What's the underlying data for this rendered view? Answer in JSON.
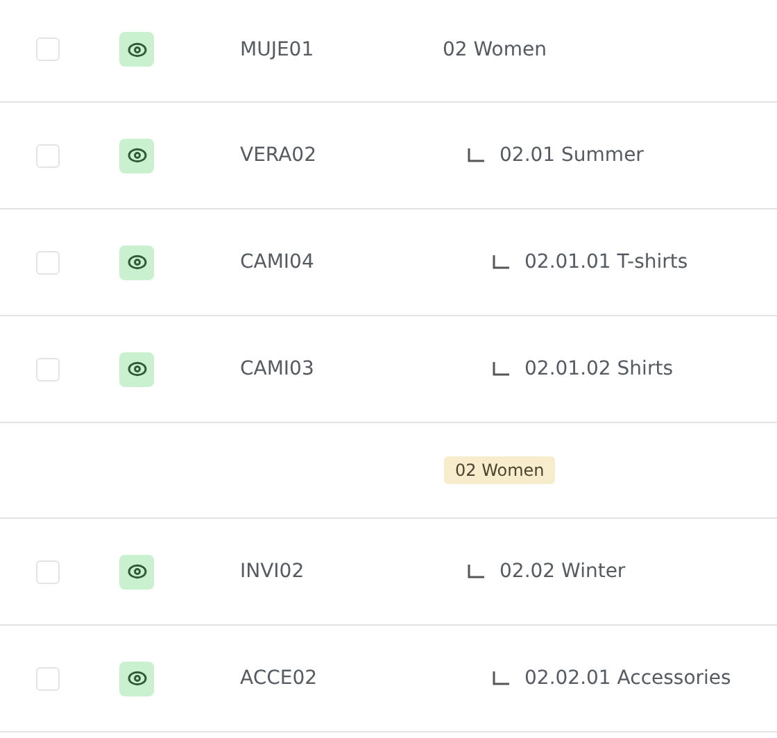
{
  "rows": [
    {
      "kind": "category",
      "checked": false,
      "code": "MUJE01",
      "name": "02 Women",
      "children": [
        {
          "kind": "category",
          "checked": false,
          "code": "VERA02",
          "name": "02.01 Summer",
          "children": [
            {
              "kind": "category",
              "checked": false,
              "code": "CAMI04",
              "name": "02.01.01 T-shirts"
            },
            {
              "kind": "category",
              "checked": false,
              "code": "CAMI03",
              "name": "02.01.02 Shirts"
            }
          ]
        },
        {
          "kind": "tag",
          "label": "02 Women"
        },
        {
          "kind": "category",
          "checked": false,
          "code": "INVI02",
          "name": "02.02 Winter",
          "children": [
            {
              "kind": "category",
              "checked": false,
              "code": "ACCE02",
              "name": "02.02.01 Accessories"
            }
          ]
        }
      ]
    }
  ]
}
